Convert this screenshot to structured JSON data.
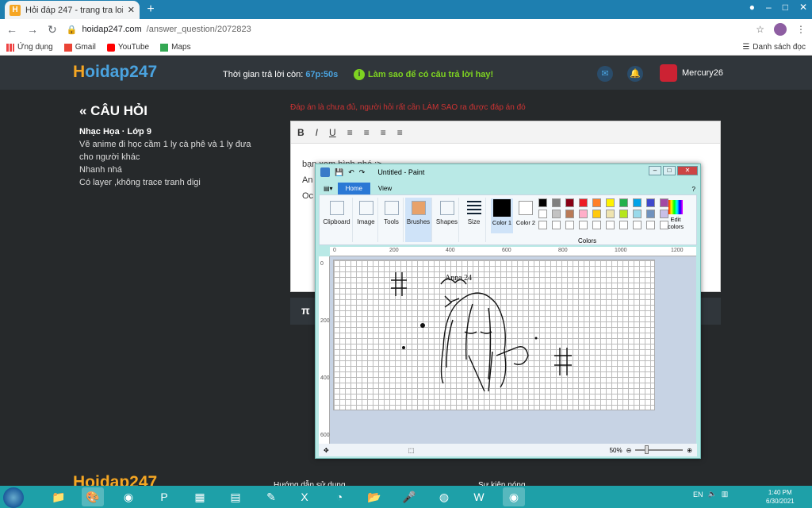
{
  "browser": {
    "tab_title": "Hỏi đáp 247 - trang tra loi",
    "url_host": "hoidap247.com",
    "url_path": "/answer_question/2072823",
    "bookmarks": [
      {
        "label": "Ứng dụng",
        "icon": "apps-icon"
      },
      {
        "label": "Gmail",
        "icon": "gmail-icon"
      },
      {
        "label": "YouTube",
        "icon": "youtube-icon"
      },
      {
        "label": "Maps",
        "icon": "maps-icon"
      }
    ],
    "reading_list": "Danh sách đọc"
  },
  "site": {
    "logo_main": "oidap247",
    "logo_first": "H",
    "timer_label": "Thời gian trả lời còn:",
    "timer_value": "67p:50s",
    "tip": "Làm sao để có câu trả lời hay!",
    "username": "Mercury26"
  },
  "question": {
    "heading": "« CÂU HỎI",
    "subject": "Nhạc Họa · Lớp 9",
    "line1": "Vẽ anime đi học cầm 1 ly cà phê và 1  ly đưa",
    "line2": "cho người khác",
    "line3": "Nhanh nhá",
    "line4": "Có layer ,không trace tranh digi"
  },
  "editor": {
    "warning": "Đáp án là chưa đủ, người hỏi rất cần LÀM SAO ra được đáp án đó",
    "text1": "bạn xem hình nhé :>",
    "text2": "An",
    "text3": "Oc",
    "tools": [
      "B",
      "I",
      "U",
      "≡",
      "≡",
      "≡",
      "≡"
    ]
  },
  "paint": {
    "title": "Untitled - Paint",
    "tabs": [
      "Home",
      "View"
    ],
    "groups": [
      "Clipboard",
      "Image",
      "Tools",
      "Brushes",
      "Shapes",
      "Size"
    ],
    "color1_label": "Color 1",
    "color2_label": "Color 2",
    "edit_colors": "Edit colors",
    "colors_label": "Colors",
    "ruler_h": [
      "0",
      "200",
      "400",
      "600",
      "800",
      "1000",
      "1200"
    ],
    "ruler_v": [
      "0",
      "200",
      "400",
      "600"
    ],
    "zoom": "50%",
    "palette": [
      "#000000",
      "#7f7f7f",
      "#880015",
      "#ed1c24",
      "#ff7f27",
      "#fff200",
      "#22b14c",
      "#00a2e8",
      "#3f48cc",
      "#a349a4",
      "#ffffff",
      "#c3c3c3",
      "#b97a57",
      "#ffaec9",
      "#ffc90e",
      "#efe4b0",
      "#b5e61d",
      "#99d9ea",
      "#7092be",
      "#c8bfe7",
      "#ffffff",
      "#ffffff",
      "#ffffff",
      "#ffffff",
      "#ffffff",
      "#ffffff",
      "#ffffff",
      "#ffffff",
      "#ffffff",
      "#ffffff"
    ]
  },
  "footer": {
    "logo": "Hoidap247",
    "link1": "Hướng dẫn sử dụng",
    "link2": "Sự kiện nóng"
  },
  "taskbar": {
    "lang": "EN",
    "time": "1:40 PM",
    "date": "6/30/2021"
  }
}
